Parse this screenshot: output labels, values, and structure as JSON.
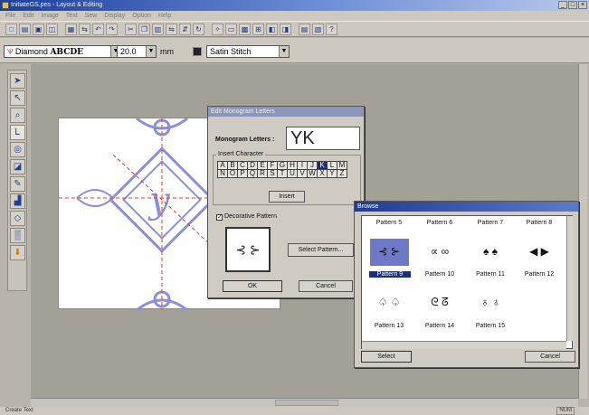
{
  "window": {
    "title": "InitiateGS.pes - Layout & Editing",
    "controls": [
      "_",
      "□",
      "×"
    ]
  },
  "menu": [
    "File",
    "Edit",
    "Image",
    "Text",
    "Sew",
    "Display",
    "Option",
    "Help"
  ],
  "toolbar2": {
    "font": "Diamond",
    "font_sample": "ABCDE",
    "size": "20.0",
    "unit": "mm",
    "stitch": "Satin Stitch"
  },
  "monogram_dialog": {
    "title": "Edit Monogram Letters",
    "letters_label": "Monogram Letters :",
    "letters_value": "YK",
    "insert_legend": "Insert Character",
    "alphabet": [
      "A",
      "B",
      "C",
      "D",
      "E",
      "F",
      "G",
      "H",
      "I",
      "J",
      "K",
      "L",
      "M",
      "N",
      "O",
      "P",
      "Q",
      "R",
      "S",
      "T",
      "U",
      "V",
      "W",
      "X",
      "Y",
      "Z"
    ],
    "selected_letter": "K",
    "insert_button": "Insert",
    "decorative_label": "Decorative Pattern",
    "decorative_checked": true,
    "select_pattern_button": "Select Pattern...",
    "ok_button": "OK",
    "cancel_button": "Cancel"
  },
  "browse_dialog": {
    "title": "Browse",
    "patterns": [
      "Pattern 5",
      "Pattern 6",
      "Pattern 7",
      "Pattern 8",
      "Pattern 9",
      "Pattern 10",
      "Pattern 11",
      "Pattern 12",
      "Pattern 13",
      "Pattern 14",
      "Pattern 15"
    ],
    "selected": "Pattern 9",
    "select_button": "Select",
    "cancel_button": "Cancel"
  },
  "status": {
    "left": "Create Text",
    "right": "NUM"
  },
  "colors": {
    "title_active": "#1b3f9e",
    "design_stitch": "#8c8fd8",
    "guide_line": "#e04020",
    "selection": "#1a2f7a"
  }
}
